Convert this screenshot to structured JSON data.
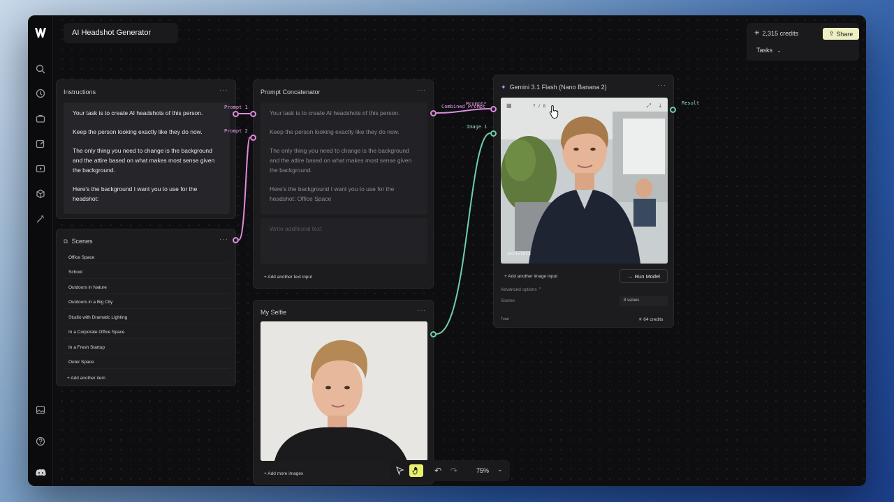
{
  "app": {
    "title": "AI Headshot Generator",
    "credits": "2,315 credits",
    "share_label": "Share",
    "tasks_label": "Tasks"
  },
  "instructions": {
    "title": "Instructions",
    "paragraphs": [
      "Your task is to create AI headshots of this person.",
      "Keep the person looking exactly like they do now.",
      "The only thing you need to change is the background and the attire based on what makes most sense given the background.",
      "Here's the background I want you to use for the headshot:"
    ]
  },
  "scenes": {
    "title": "Scenes",
    "items": [
      "Office Space",
      "School",
      "Outdoors in Nature",
      "Outdoors in a Big City",
      "Studio with Dramatic Lighting",
      "In a Corporate Office Space",
      "In a Fresh Startup",
      "Outer Space"
    ],
    "add_label": "+ Add another item"
  },
  "concat": {
    "title": "Prompt Concatenator",
    "paragraphs": [
      "Your task is to create AI headshots of this person.",
      "Keep the person looking exactly like they do now.",
      "The only thing you need to change is the background and the attire based on what makes most sense given the background.",
      "Here's the background I want you to use for the headshot: Office Space"
    ],
    "placeholder": "Write additional text",
    "add_label": "+ Add another text input",
    "port_prompt1": "Prompt 1",
    "port_prompt2": "Prompt 2",
    "port_out": "Combined Prompt"
  },
  "selfie": {
    "title": "My Selfie",
    "add_label": "+ Add more images"
  },
  "gemini": {
    "title": "Gemini 3.1 Flash (Nano Banana 2)",
    "counter": "7 / 8",
    "resolution": "1024x1024",
    "add_image_label": "+ Add another image input",
    "run_label": "Run Model",
    "advanced_label": "Advanced options",
    "scenes_label": "Scenes",
    "scenes_value": "8 values",
    "total_label": "Total",
    "total_value": "64 credits",
    "port_prompt": "Prompt*",
    "port_image": "Image 1",
    "port_result": "Result"
  },
  "toolbar": {
    "zoom": "75%"
  },
  "colors": {
    "accent_pink": "#e08ae0",
    "accent_green": "#6fd0a8",
    "share_bg": "#efefc4",
    "hand_active": "#e9f06a"
  }
}
